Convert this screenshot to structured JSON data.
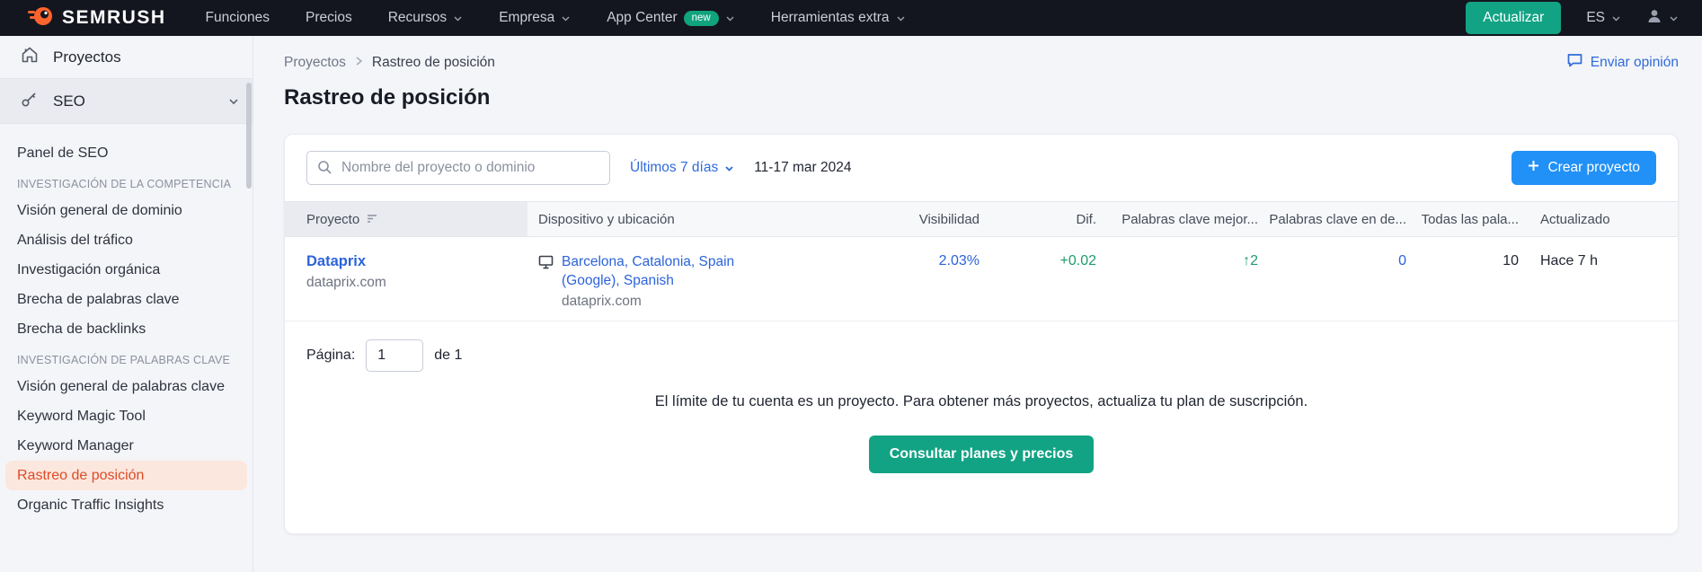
{
  "colors": {
    "brand_orange": "#ff642d",
    "green": "#12a384",
    "link_blue": "#2c63d9",
    "create_blue": "#2191f7",
    "active_orange": "#dd4b27",
    "nav_bg": "#14161f"
  },
  "topnav": {
    "logo_text": "SEMRUSH",
    "items": [
      {
        "label": "Funciones"
      },
      {
        "label": "Precios"
      },
      {
        "label": "Recursos"
      },
      {
        "label": "Empresa"
      },
      {
        "label": "App Center",
        "badge": "new"
      },
      {
        "label": "Herramientas extra"
      }
    ],
    "update_button": "Actualizar",
    "language": "ES"
  },
  "sidebar": {
    "projects": "Proyectos",
    "seo": "SEO",
    "panel": "Panel de SEO",
    "section1": "INVESTIGACIÓN DE LA COMPETENCIA",
    "s1_items": [
      "Visión general de dominio",
      "Análisis del tráfico",
      "Investigación orgánica",
      "Brecha de palabras clave",
      "Brecha de backlinks"
    ],
    "section2": "INVESTIGACIÓN DE PALABRAS CLAVE",
    "s2_items": [
      "Visión general de palabras clave",
      "Keyword Magic Tool",
      "Keyword Manager",
      "Rastreo de posición",
      "Organic Traffic Insights"
    ],
    "active_item": "Rastreo de posición"
  },
  "header": {
    "breadcrumb1": "Proyectos",
    "breadcrumb2": "Rastreo de posición",
    "title": "Rastreo de posición",
    "feedback": "Enviar opinión"
  },
  "toolbar": {
    "search_placeholder": "Nombre del proyecto o dominio",
    "date_filter": "Últimos 7 días",
    "date_range": "11-17 mar 2024",
    "create_button": "Crear proyecto"
  },
  "table": {
    "headers": [
      "Proyecto",
      "Dispositivo y ubicación",
      "Visibilidad",
      "Dif.",
      "Palabras clave mejor...",
      "Palabras clave en de...",
      "Todas las pala...",
      "Actualizado"
    ],
    "row": {
      "name": "Dataprix",
      "domain": "dataprix.com",
      "location_link": "Barcelona, Catalonia, Spain (Google), Spanish",
      "location_domain": "dataprix.com",
      "visibility": "2.03%",
      "diff": "+0.02",
      "improved": "↑2",
      "declined": "0",
      "total": "10",
      "updated": "Hace 7 h"
    }
  },
  "pagination": {
    "label": "Página:",
    "value": "1",
    "of": "de 1"
  },
  "footer": {
    "limit_message": "El límite de tu cuenta es un proyecto. Para obtener más proyectos, actualiza tu plan de suscripción.",
    "cta_button": "Consultar planes y precios"
  }
}
